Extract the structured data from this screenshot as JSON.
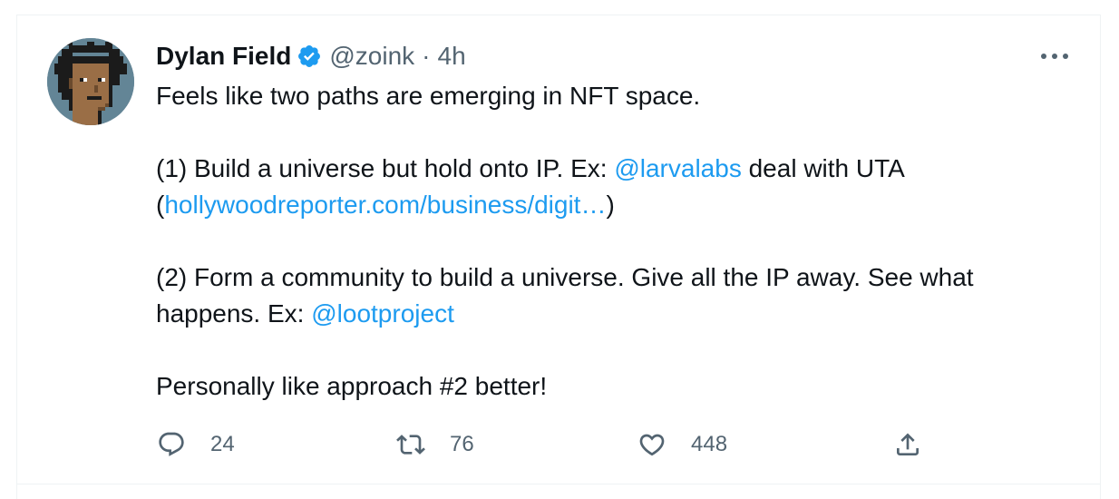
{
  "tweet": {
    "author": {
      "name": "Dylan Field",
      "handle": "@zoink",
      "verified_icon": "verified-badge-icon",
      "avatar": "pixel-art-avatar"
    },
    "separator": "·",
    "time": "4h",
    "more_icon": "more-dots-icon",
    "text": {
      "line1": "Feels like two paths are emerging in NFT space.",
      "p2_prefix": "(1) Build a universe but hold onto IP. Ex: ",
      "p2_mention": "@larvalabs",
      "p2_suffix": " deal with UTA",
      "p3_open": "(",
      "p3_link": "hollywoodreporter.com/business/digit…",
      "p3_close": ")",
      "p4_prefix": "(2) Form a community to build a universe. Give all the IP away. See what",
      "p5_prefix": "happens. Ex: ",
      "p5_mention": "@lootproject",
      "p6": "Personally like approach #2 better!"
    },
    "actions": {
      "reply": {
        "icon": "reply-icon",
        "count": "24"
      },
      "retweet": {
        "icon": "retweet-icon",
        "count": "76"
      },
      "like": {
        "icon": "heart-icon",
        "count": "448"
      },
      "share": {
        "icon": "share-icon"
      }
    }
  },
  "colors": {
    "link": "#1d9bf0",
    "secondary": "#536471",
    "text": "#0f1419",
    "verified": "#1d9bf0",
    "avatar_bg": "#638596"
  }
}
